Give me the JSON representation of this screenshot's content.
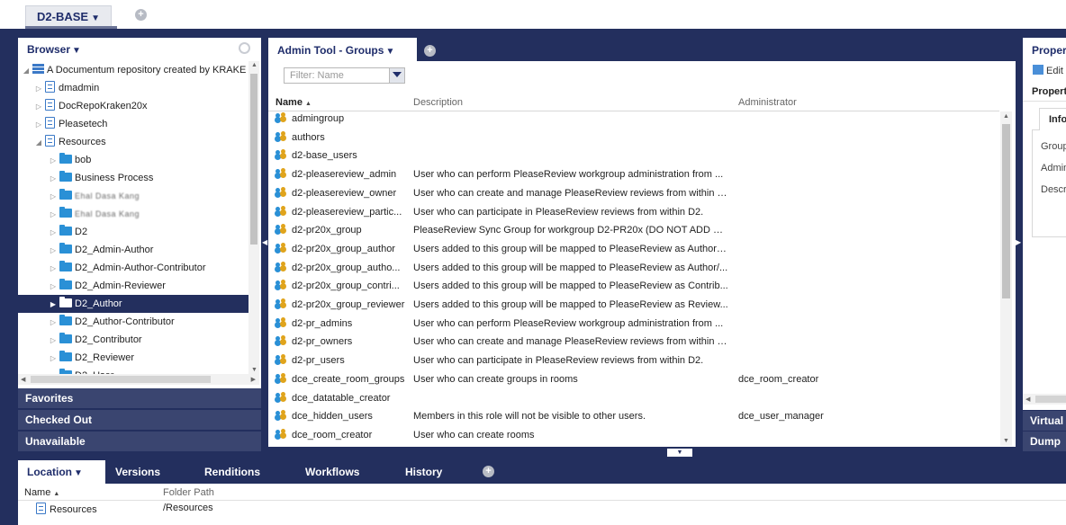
{
  "workspace": {
    "tab_label": "D2-BASE",
    "caret": "▼"
  },
  "browser": {
    "title": "Browser",
    "tree": [
      {
        "label": "A Documentum repository created by KRAKE",
        "icon": "repository-icon",
        "toggle": "◢",
        "level": 0
      },
      {
        "label": "dmadmin",
        "icon": "cabinet-icon",
        "toggle": "▷",
        "level": 1
      },
      {
        "label": "DocRepoKraken20x",
        "icon": "cabinet-icon",
        "toggle": "▷",
        "level": 1
      },
      {
        "label": "Pleasetech",
        "icon": "cabinet-icon",
        "toggle": "▷",
        "level": 1
      },
      {
        "label": "Resources",
        "icon": "cabinet-icon",
        "toggle": "◢",
        "level": 1
      },
      {
        "label": "bob",
        "icon": "folder-icon",
        "toggle": "▷",
        "level": 2
      },
      {
        "label": "Business Process",
        "icon": "folder-icon",
        "toggle": "▷",
        "level": 2
      },
      {
        "label": "Ehal Dasa Kang",
        "icon": "folder-icon",
        "toggle": "▷",
        "level": 2,
        "blurred": true
      },
      {
        "label": "Ehal Dasa Kang",
        "icon": "folder-icon",
        "toggle": "▷",
        "level": 2,
        "blurred": true
      },
      {
        "label": "D2",
        "icon": "folder-icon",
        "toggle": "▷",
        "level": 2
      },
      {
        "label": "D2_Admin-Author",
        "icon": "folder-icon",
        "toggle": "▷",
        "level": 2
      },
      {
        "label": "D2_Admin-Author-Contributor",
        "icon": "folder-icon",
        "toggle": "▷",
        "level": 2
      },
      {
        "label": "D2_Admin-Reviewer",
        "icon": "folder-icon",
        "toggle": "▷",
        "level": 2
      },
      {
        "label": "D2_Author",
        "icon": "folder-icon",
        "toggle": "▶",
        "level": 2,
        "selected": true
      },
      {
        "label": "D2_Author-Contributor",
        "icon": "folder-icon",
        "toggle": "▷",
        "level": 2
      },
      {
        "label": "D2_Contributor",
        "icon": "folder-icon",
        "toggle": "▷",
        "level": 2
      },
      {
        "label": "D2_Reviewer",
        "icon": "folder-icon",
        "toggle": "▷",
        "level": 2
      },
      {
        "label": "D2_User",
        "icon": "folder-icon",
        "toggle": "▷",
        "level": 2
      }
    ]
  },
  "accordion": [
    "Favorites",
    "Checked Out",
    "Unavailable"
  ],
  "groups_panel": {
    "tab_label": "Admin Tool - Groups",
    "filter_placeholder": "Filter: Name",
    "columns": {
      "name": "Name",
      "description": "Description",
      "administrator": "Administrator"
    },
    "rows": [
      {
        "name": "admingroup",
        "description": "",
        "admin": ""
      },
      {
        "name": "authors",
        "description": "",
        "admin": ""
      },
      {
        "name": "d2-base_users",
        "description": "",
        "admin": ""
      },
      {
        "name": "d2-pleasereview_admin",
        "description": "User who can perform PleaseReview workgroup administration from ...",
        "admin": ""
      },
      {
        "name": "d2-pleasereview_owner",
        "description": "User who can create and manage PleaseReview reviews from within D2.",
        "admin": ""
      },
      {
        "name": "d2-pleasereview_partic...",
        "description": "User who can participate in PleaseReview reviews from within D2.",
        "admin": ""
      },
      {
        "name": "d2-pr20x_group",
        "description": "PleaseReview Sync Group for workgroup D2-PR20x (DO NOT ADD MEM...",
        "admin": ""
      },
      {
        "name": "d2-pr20x_group_author",
        "description": "Users added to this group will be mapped to PleaseReview as Authors...",
        "admin": ""
      },
      {
        "name": "d2-pr20x_group_autho...",
        "description": "Users added to this group will be mapped to PleaseReview as Author/...",
        "admin": ""
      },
      {
        "name": "d2-pr20x_group_contri...",
        "description": "Users added to this group will be mapped to PleaseReview as Contrib...",
        "admin": ""
      },
      {
        "name": "d2-pr20x_group_reviewer",
        "description": "Users added to this group will be mapped to PleaseReview as Review...",
        "admin": ""
      },
      {
        "name": "d2-pr_admins",
        "description": "User who can perform PleaseReview workgroup administration from ...",
        "admin": ""
      },
      {
        "name": "d2-pr_owners",
        "description": "User who can create and manage PleaseReview reviews from within D2.",
        "admin": ""
      },
      {
        "name": "d2-pr_users",
        "description": "User who can participate in PleaseReview reviews from within D2.",
        "admin": ""
      },
      {
        "name": "dce_create_room_groups",
        "description": "User who can create groups in rooms",
        "admin": "dce_room_creator"
      },
      {
        "name": "dce_datatable_creator",
        "description": "",
        "admin": ""
      },
      {
        "name": "dce_hidden_users",
        "description": "Members in this role will not be visible to other users.",
        "admin": "dce_user_manager"
      },
      {
        "name": "dce_room_creator",
        "description": "User who can create rooms",
        "admin": ""
      }
    ]
  },
  "properties_panel": {
    "tab_label": "Properties",
    "edit_label": "Edit",
    "title": "Properties",
    "info_tab": "Info",
    "labels": [
      "Group",
      "Admin",
      "Description"
    ],
    "accordion": [
      "Virtual",
      "Dump"
    ]
  },
  "bottom_panel": {
    "tabs": [
      "Location",
      "Versions",
      "Renditions",
      "Workflows",
      "History"
    ],
    "columns": {
      "name": "Name",
      "path": "Folder Path"
    },
    "row": {
      "name": "Resources",
      "path": "/Resources"
    }
  }
}
